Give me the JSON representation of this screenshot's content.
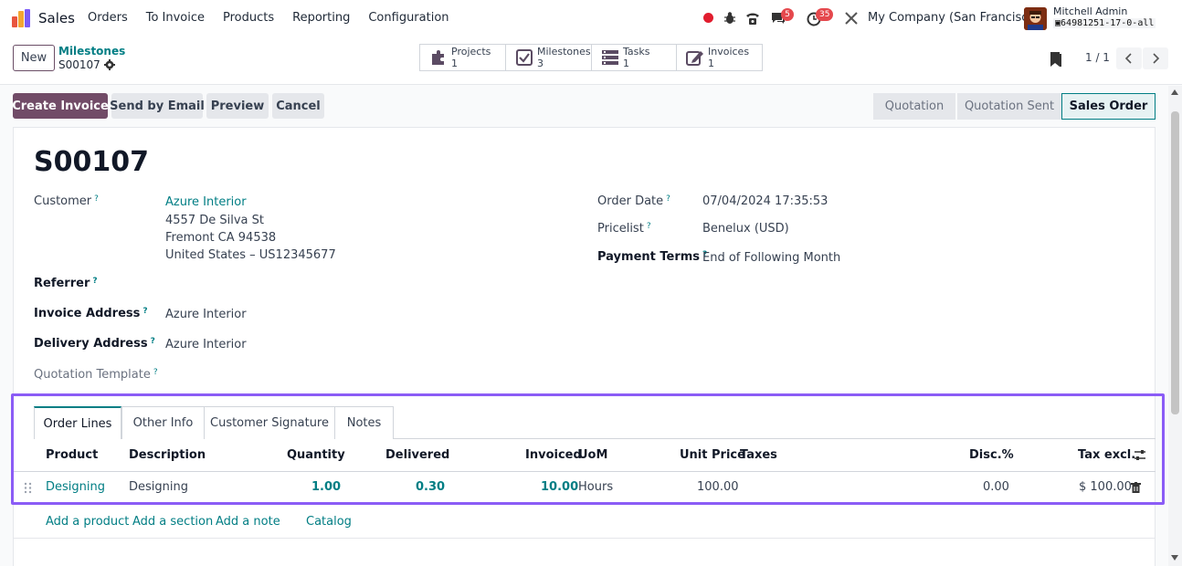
{
  "app": {
    "name": "Sales"
  },
  "nav": [
    "Orders",
    "To Invoice",
    "Products",
    "Reporting",
    "Configuration"
  ],
  "systray": {
    "messages_badge": "5",
    "activities_badge": "35",
    "company": "My Company (San Francisco)",
    "user_name": "Mitchell Admin",
    "db_name": "64981251-17-0-all"
  },
  "control": {
    "new_label": "New",
    "breadcrumb_parent": "Milestones",
    "breadcrumb_current": "S00107",
    "smart_buttons": [
      {
        "label": "Projects",
        "count": "1",
        "icon": "puzzle-icon"
      },
      {
        "label": "Milestones",
        "count": "3",
        "icon": "check-square-icon"
      },
      {
        "label": "Tasks",
        "count": "1",
        "icon": "tasks-icon"
      },
      {
        "label": "Invoices",
        "count": "1",
        "icon": "pencil-square-icon"
      }
    ],
    "pager": "1 / 1"
  },
  "actions": {
    "create_invoice": "Create Invoice",
    "send_email": "Send by Email",
    "preview": "Preview",
    "cancel": "Cancel"
  },
  "stages": [
    "Quotation",
    "Quotation Sent",
    "Sales Order"
  ],
  "record": {
    "name": "S00107",
    "customer_label": "Customer",
    "customer_name": "Azure Interior",
    "customer_addr1": "4557 De Silva St",
    "customer_addr2": "Fremont CA 94538",
    "customer_addr3": "United States – US12345677",
    "referrer_label": "Referrer",
    "invoice_address_label": "Invoice Address",
    "invoice_address": "Azure Interior",
    "delivery_address_label": "Delivery Address",
    "delivery_address": "Azure Interior",
    "quotation_template_label": "Quotation Template",
    "order_date_label": "Order Date",
    "order_date": "07/04/2024 17:35:53",
    "pricelist_label": "Pricelist",
    "pricelist": "Benelux (USD)",
    "payment_terms_label": "Payment Terms",
    "payment_terms": "End of Following Month",
    "help_mark": "?"
  },
  "tabs": [
    "Order Lines",
    "Other Info",
    "Customer Signature",
    "Notes"
  ],
  "lines": {
    "headers": {
      "product": "Product",
      "description": "Description",
      "quantity": "Quantity",
      "delivered": "Delivered",
      "invoiced": "Invoiced",
      "uom": "UoM",
      "unit_price": "Unit Price",
      "taxes": "Taxes",
      "disc": "Disc.%",
      "tax_excl": "Tax excl."
    },
    "rows": [
      {
        "product": "Designing",
        "description": "Designing",
        "quantity": "1.00",
        "delivered": "0.30",
        "invoiced": "10.00",
        "uom": "Hours",
        "unit_price": "100.00",
        "taxes": "",
        "disc": "0.00",
        "tax_excl": "$ 100.00"
      }
    ],
    "add_product": "Add a product",
    "add_section": "Add a section",
    "add_note": "Add a note",
    "catalog": "Catalog"
  },
  "colors": {
    "primary": "#714b67",
    "link": "#017e84",
    "highlight": "#8b5cf6"
  }
}
